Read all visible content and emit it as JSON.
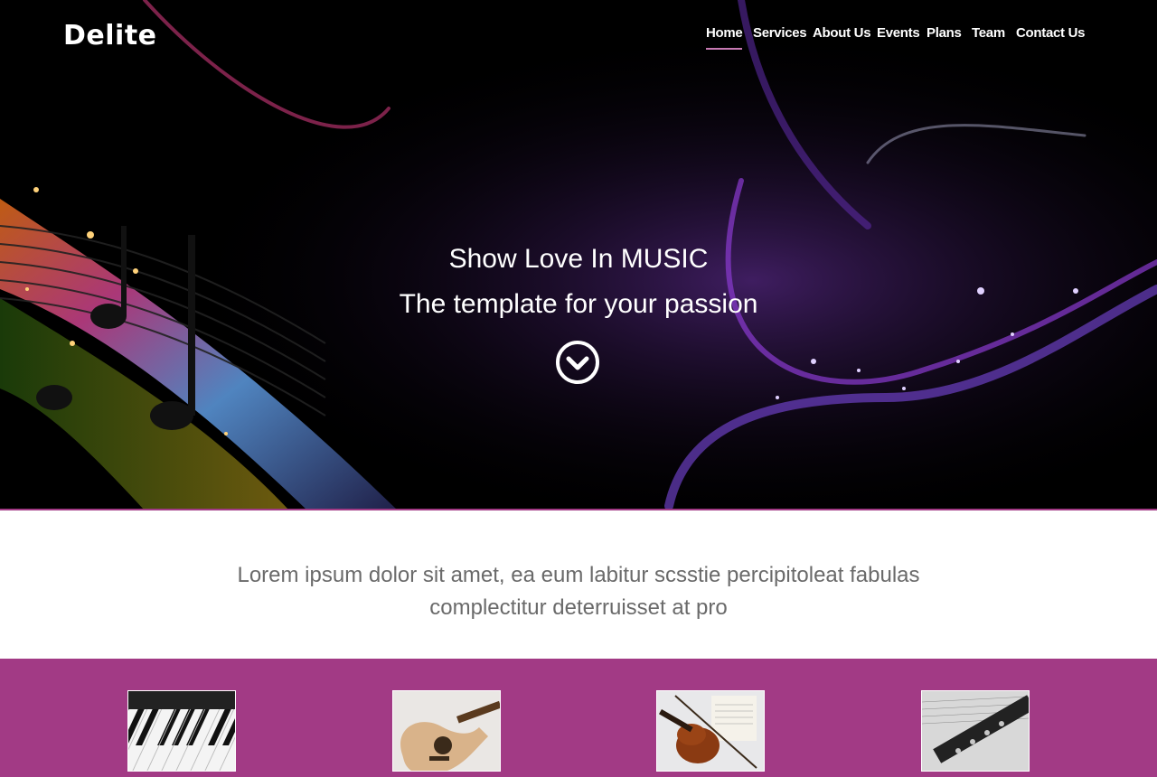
{
  "brand": {
    "name": "Delite"
  },
  "nav": {
    "items": [
      {
        "label": "Home",
        "active": true
      },
      {
        "label": "Services",
        "active": false
      },
      {
        "label": "About Us",
        "active": false
      },
      {
        "label": "Events",
        "active": false
      },
      {
        "label": "Plans",
        "active": false
      },
      {
        "label": "Team",
        "active": false
      },
      {
        "label": "Contact Us",
        "active": false
      }
    ]
  },
  "hero": {
    "title": "Show Love In MUSIC",
    "subtitle": "The template for your passion",
    "scroll_icon": "chevron-down-circle-icon"
  },
  "intro": {
    "text": "Lorem ipsum dolor sit amet, ea eum labitur scsstie percipitoleat fabulas complectitur deterruisset at pro"
  },
  "instruments": [
    {
      "name": "piano-thumbnail"
    },
    {
      "name": "guitar-thumbnail"
    },
    {
      "name": "violin-thumbnail"
    },
    {
      "name": "clarinet-thumbnail"
    }
  ],
  "colors": {
    "accent": "#a23a85",
    "hero_bg": "#000000",
    "intro_text": "#6a6a6a"
  }
}
